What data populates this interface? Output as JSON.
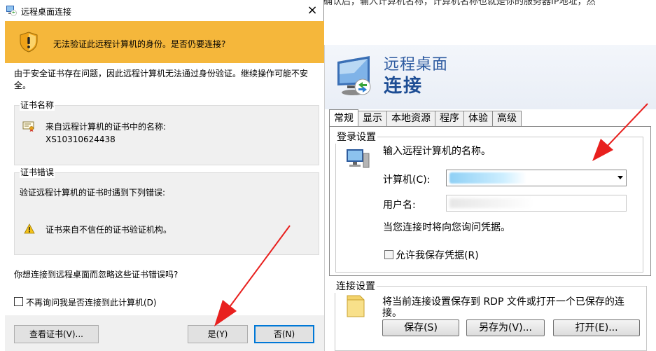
{
  "article": {
    "line": "确认后，输入计算机名称，计算机名称也就是你的服务器IP地址，然"
  },
  "dialog": {
    "title": "远程桌面连接",
    "close": "×",
    "warning": "无法验证此远程计算机的身份。是否仍要连接?",
    "message": "由于安全证书存在问题，因此远程计算机无法通过身份验证。继续操作可能不安全。",
    "cert_name": {
      "legend": "证书名称",
      "label": "来自远程计算机的证书中的名称:",
      "value": "XS10310624438"
    },
    "cert_errors": {
      "legend": "证书错误",
      "intro": "验证远程计算机的证书时遇到下列错误:",
      "error": "证书来自不信任的证书验证机构。"
    },
    "question": "你想连接到远程桌面而忽略这些证书错误吗?",
    "dont_ask": "不再询问我是否连接到此计算机(D)",
    "buttons": {
      "view_cert": "查看证书(V)...",
      "yes": "是(Y)",
      "no": "否(N)"
    }
  },
  "rdp": {
    "title_line1": "远程桌面",
    "title_line2": "连接",
    "tabs": [
      "常规",
      "显示",
      "本地资源",
      "程序",
      "体验",
      "高级"
    ],
    "login": {
      "legend": "登录设置",
      "prompt": "输入远程计算机的名称。",
      "computer_label": "计算机(C):",
      "user_label": "用户名:",
      "note": "当您连接时将向您询问凭据。",
      "allow_save": "允许我保存凭据(R)"
    },
    "connection": {
      "legend": "连接设置",
      "text_line1": "将当前连接设置保存到 RDP 文件或打开一个已保存的连",
      "text_line2": "接。",
      "save": "保存(S)",
      "save_as": "另存为(V)...",
      "open": "打开(E)..."
    }
  },
  "colors": {
    "warning_band": "#f5b73b",
    "default_button_border": "#0078d7",
    "annotation_arrow": "#e8201e",
    "rdp_title": "#2d5aa0"
  }
}
